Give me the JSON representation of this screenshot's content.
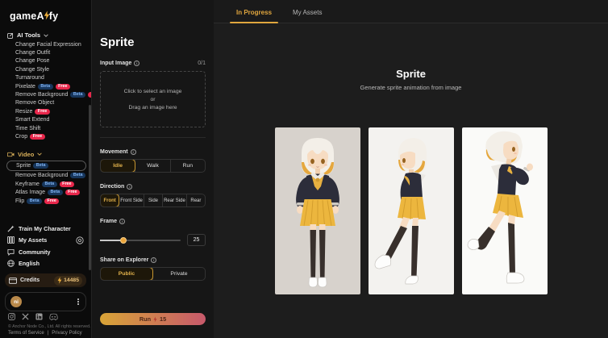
{
  "colors": {
    "accent_gold": "#e0a63e",
    "beta_badge_bg": "#17365c",
    "beta_badge_text": "#7fb1ef",
    "free_badge_bg": "#e8274b",
    "run_gradient_start": "#d8a437",
    "run_gradient_end": "#c7596b",
    "sidebar_bg": "#0b0b0b",
    "panel_bg": "#161616",
    "main_bg": "#1d1d1d"
  },
  "sidebar": {
    "logo": {
      "part1": "game",
      "part2": "A",
      "part3": "fy"
    },
    "ai_tools": {
      "label": "AI Tools",
      "items": [
        {
          "label": "Change Facial Expression",
          "badges": []
        },
        {
          "label": "Change Outfit",
          "badges": []
        },
        {
          "label": "Change Pose",
          "badges": []
        },
        {
          "label": "Change Style",
          "badges": []
        },
        {
          "label": "Turnaround",
          "badges": []
        },
        {
          "label": "Pixelate",
          "badges": [
            "Beta",
            "Free"
          ]
        },
        {
          "label": "Remove Background",
          "badges": [
            "Beta",
            "Free"
          ]
        },
        {
          "label": "Remove Object",
          "badges": []
        },
        {
          "label": "Resize",
          "badges": [
            "Free"
          ]
        },
        {
          "label": "Smart Extend",
          "badges": []
        },
        {
          "label": "Time Shift",
          "badges": []
        },
        {
          "label": "Crop",
          "badges": [
            "Free"
          ]
        }
      ]
    },
    "video": {
      "label": "Video",
      "selected": "Sprite",
      "items": [
        {
          "label": "Sprite",
          "badges": [
            "Beta"
          ]
        },
        {
          "label": "Remove Background",
          "badges": [
            "Beta"
          ]
        },
        {
          "label": "Keyframe",
          "badges": [
            "Beta",
            "Free"
          ]
        },
        {
          "label": "Atlas Image",
          "badges": [
            "Beta",
            "Free"
          ]
        },
        {
          "label": "Flip",
          "badges": [
            "Beta",
            "Free"
          ]
        }
      ]
    },
    "footer_items": {
      "train": "Train My Character",
      "assets": "My Assets",
      "community": "Community",
      "language": "English"
    },
    "credits": {
      "label": "Credits",
      "amount": "14485"
    },
    "user": {
      "initials": "ni"
    },
    "copyright": "© Anchor Node Co., Ltd. All rights reserved.",
    "legal": {
      "terms": "Terms of Service",
      "separator": "|",
      "privacy": "Privacy Policy"
    }
  },
  "panel": {
    "title": "Sprite",
    "input_image": {
      "label": "Input Image",
      "counter": "0/1",
      "line1": "Click to select an image",
      "line2": "or",
      "line3": "Drag an image here"
    },
    "movement": {
      "label": "Movement",
      "options": [
        "Idle",
        "Walk",
        "Run"
      ],
      "selected": "Idle"
    },
    "direction": {
      "label": "Direction",
      "options": [
        "Front",
        "Front Side",
        "Side",
        "Rear Side",
        "Rear"
      ],
      "selected": "Front"
    },
    "frame": {
      "label": "Frame",
      "value": "25"
    },
    "share": {
      "label": "Share on Explorer",
      "options": [
        "Public",
        "Private"
      ],
      "selected": "Public"
    },
    "run": {
      "label": "Run",
      "cost": "15"
    }
  },
  "main": {
    "tabs": [
      {
        "label": "In Progress",
        "active": true
      },
      {
        "label": "My Assets",
        "active": false
      }
    ],
    "title": "Sprite",
    "subtitle": "Generate sprite animation from image",
    "frames": [
      "sprite-front-view",
      "sprite-walk-view",
      "sprite-run-view"
    ]
  }
}
